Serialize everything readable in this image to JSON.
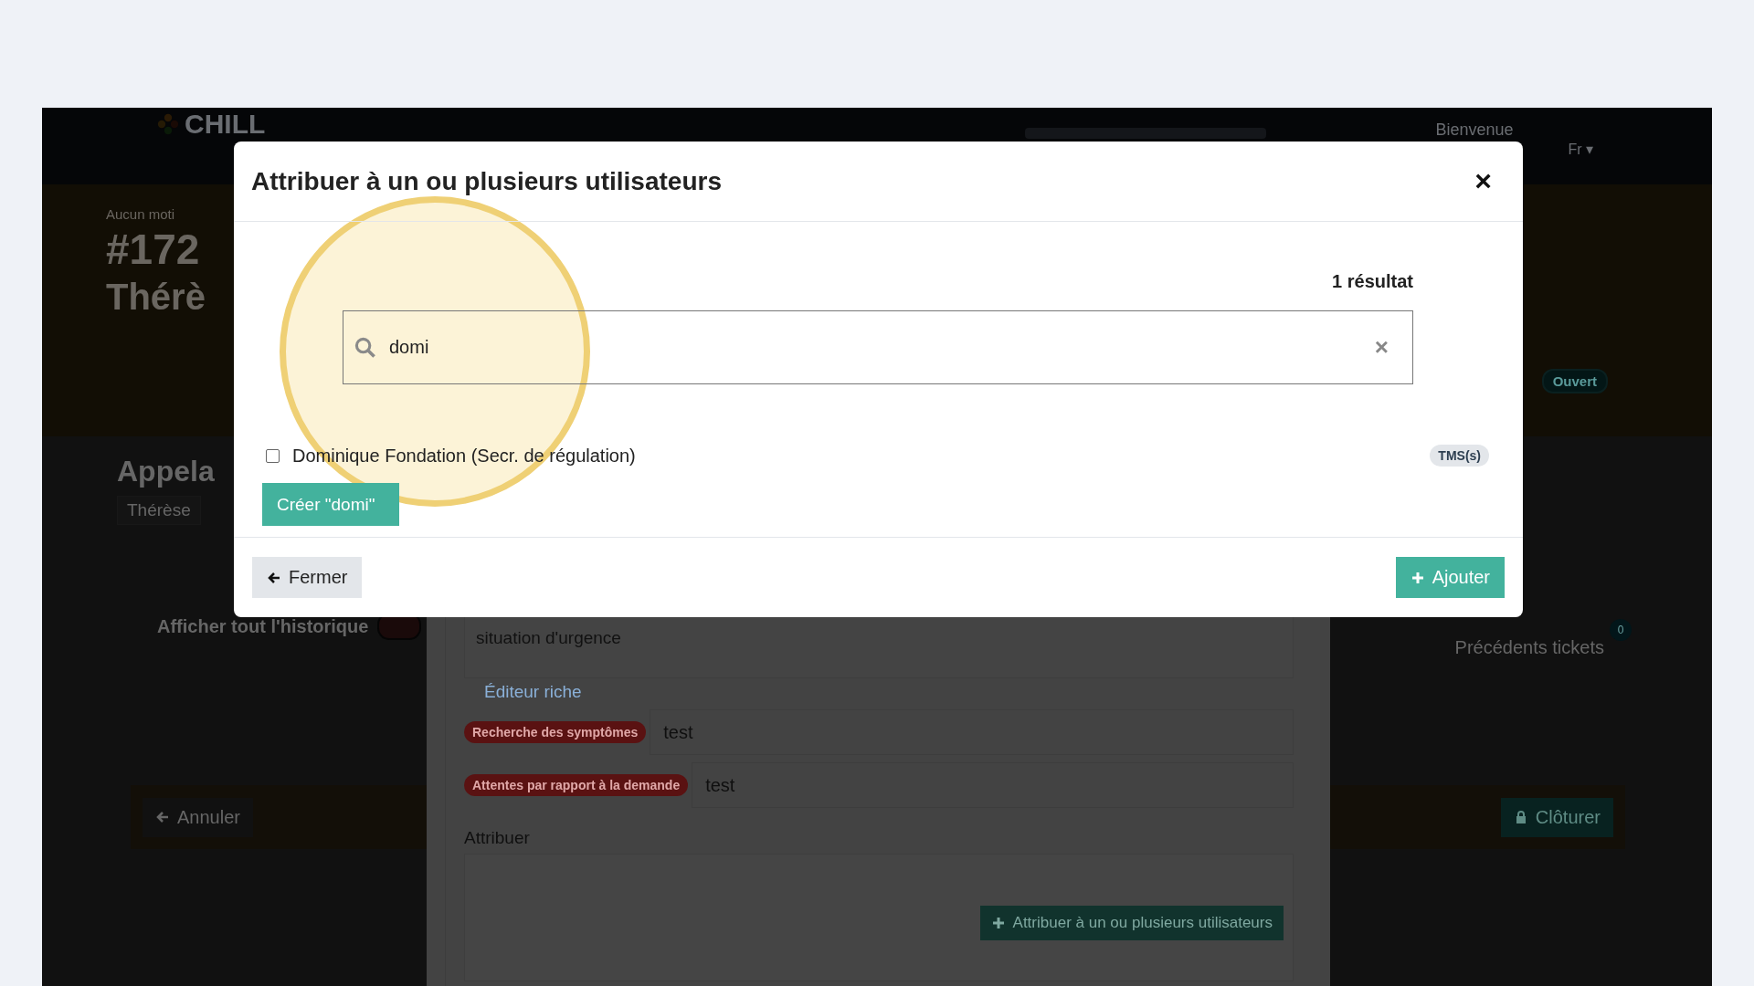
{
  "app": {
    "logo": "CHILL",
    "welcome": "Bienvenue",
    "language": "Fr ▾",
    "ticket": {
      "motive": "Aucun moti",
      "number": "#172",
      "person": "Thérè",
      "status_badge": "Ouvert"
    },
    "caller_heading": "Appela",
    "caller_chip": "Thérèse",
    "history_toggle": {
      "label": "Afficher tout l'historique",
      "on": false
    },
    "previous_tickets": {
      "label": "Précédents tickets",
      "count": "0"
    },
    "cancel_button": "Annuler",
    "close_ticket_button": "Clôturer"
  },
  "panel": {
    "description": "situation d'urgence",
    "rich_editor_link": "Éditeur riche",
    "fields": [
      {
        "label": "Recherche des symptômes",
        "value": "test"
      },
      {
        "label": "Attentes par rapport à la demande",
        "value": "test"
      }
    ],
    "assign_label": "Attribuer",
    "assign_button": "Attribuer à un ou plusieurs utilisateurs"
  },
  "modal": {
    "title": "Attribuer à un ou plusieurs utilisateurs",
    "close": "×",
    "result_count": "1 résultat",
    "search": {
      "value": "domi",
      "clear": "×"
    },
    "results": [
      {
        "name": "Dominique Fondation (Secr. de régulation)",
        "checked": false,
        "tag": "TMS(s)"
      }
    ],
    "create_button": "Créer \"domi\"",
    "footer": {
      "back_button": "Fermer",
      "add_button": "Ajouter"
    }
  }
}
